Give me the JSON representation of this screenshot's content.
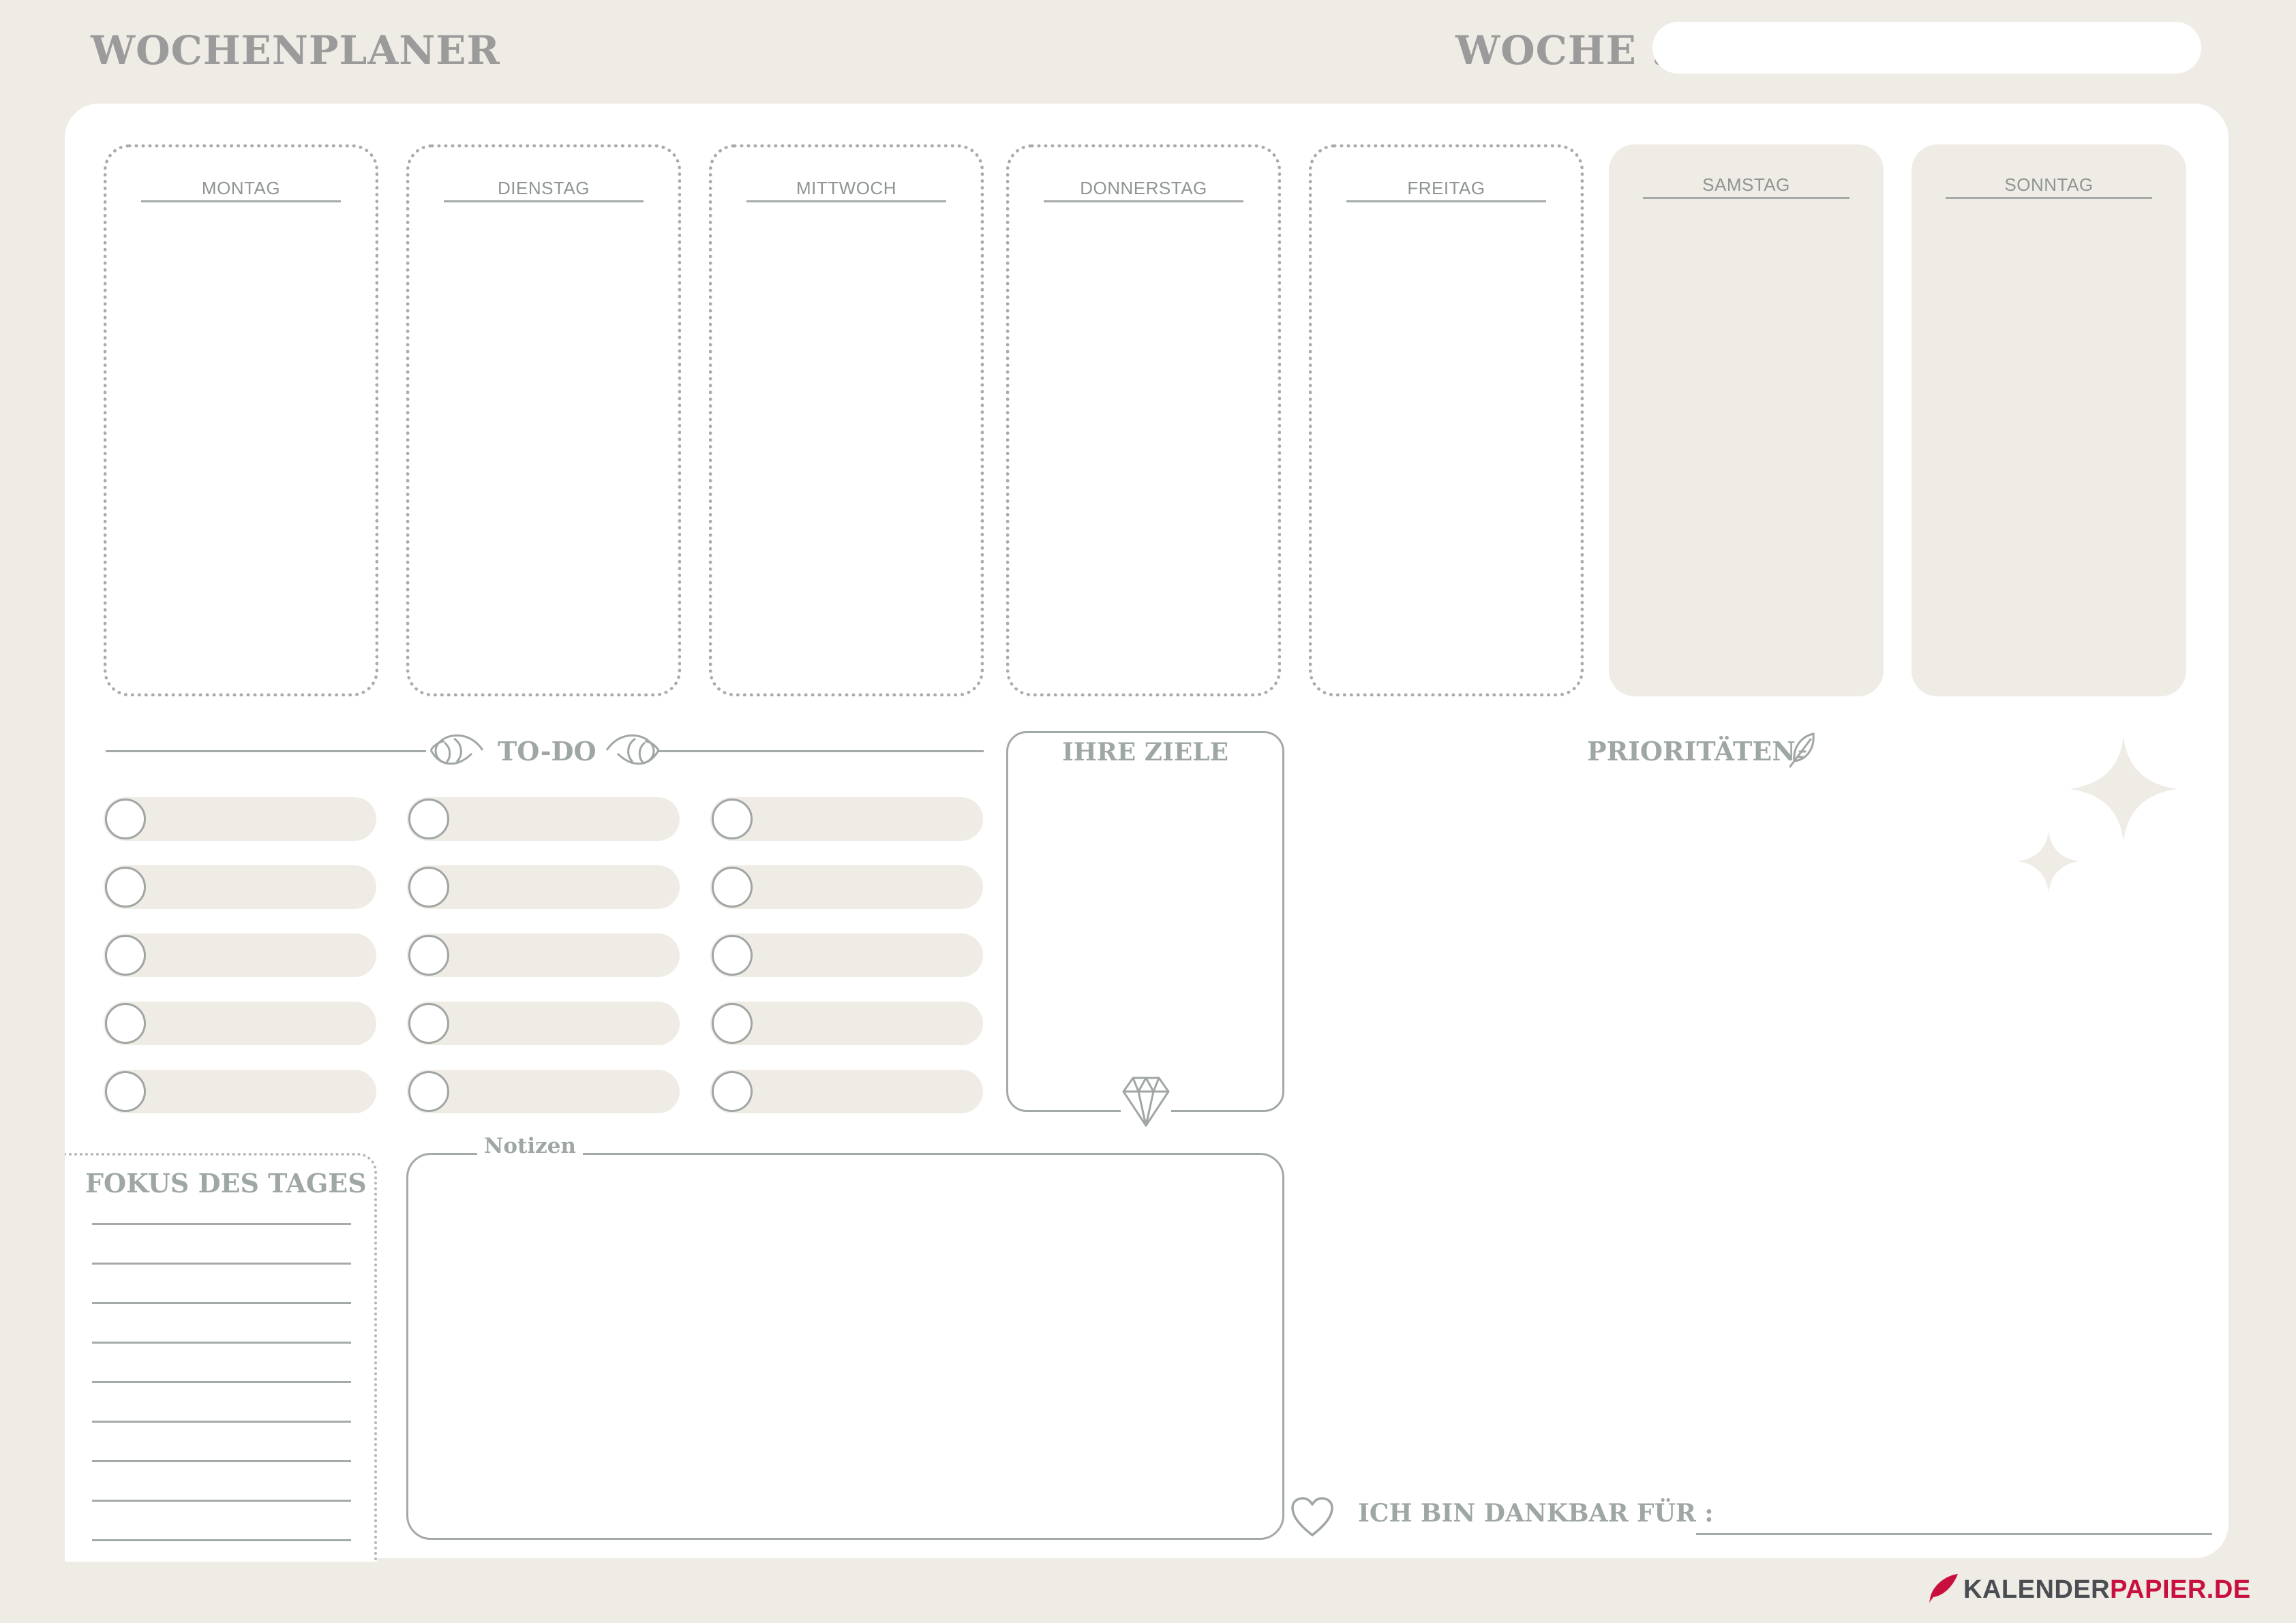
{
  "header": {
    "title": "WOCHENPLANER",
    "week_label": "WOCHE :"
  },
  "days": [
    "MONTAG",
    "DIENSTAG",
    "MITTWOCH",
    "DONNERSTAG",
    "FREITAG",
    "SAMSTAG",
    "SONNTAG"
  ],
  "todo": {
    "label": "TO-DO"
  },
  "goals": {
    "label": "IHRE ZIELE"
  },
  "priorities": {
    "label": "PRIORITÄTEN"
  },
  "focus": {
    "label": "FOKUS DES TAGES"
  },
  "notes": {
    "label": "Notizen"
  },
  "gratitude": {
    "label": "ICH BIN DANKBAR FÜR :"
  },
  "brand": {
    "part1": "KALENDER",
    "part2": "PAPIER.DE",
    "accent_color": "#c8103e"
  },
  "icons": [
    "rose-icon",
    "feather-icon",
    "diamond-icon",
    "heart-icon",
    "sparkle-icon",
    "quill-logo-icon"
  ],
  "colors": {
    "background": "#efebe5",
    "card": "#ffffff",
    "text": "#9ea3a1",
    "accent": "#c8103e"
  }
}
